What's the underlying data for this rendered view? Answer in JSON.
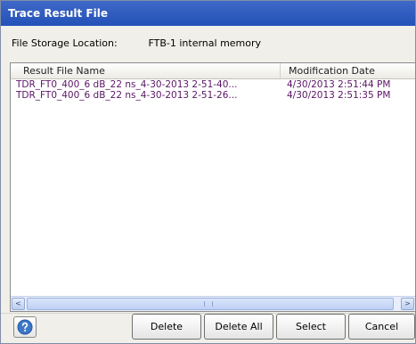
{
  "dialog": {
    "title": "Trace Result File",
    "storage_label": "File Storage Location:",
    "storage_value": "FTB-1 internal memory"
  },
  "table": {
    "columns": [
      "Result File Name",
      "Modification Date"
    ],
    "rows": [
      {
        "name": "TDR_FT0_400_6 dB_22 ns_4-30-2013 2-51-40...",
        "date": "4/30/2013 2:51:44 PM"
      },
      {
        "name": "TDR_FT0_400_6 dB_22 ns_4-30-2013 2-51-26...",
        "date": "4/30/2013 2:51:35 PM"
      }
    ],
    "scrollbar": {
      "left_icon": "scroll-left-icon",
      "right_icon": "scroll-right-icon",
      "left_glyph": "<",
      "right_glyph": ">"
    }
  },
  "buttons": {
    "help_icon": "help-icon",
    "delete": "Delete",
    "delete_all": "Delete All",
    "select": "Select",
    "cancel": "Cancel"
  },
  "colors": {
    "title_bar": "#2f5cc1",
    "row_text": "#5a1565",
    "help_icon": "#3d78c8"
  }
}
